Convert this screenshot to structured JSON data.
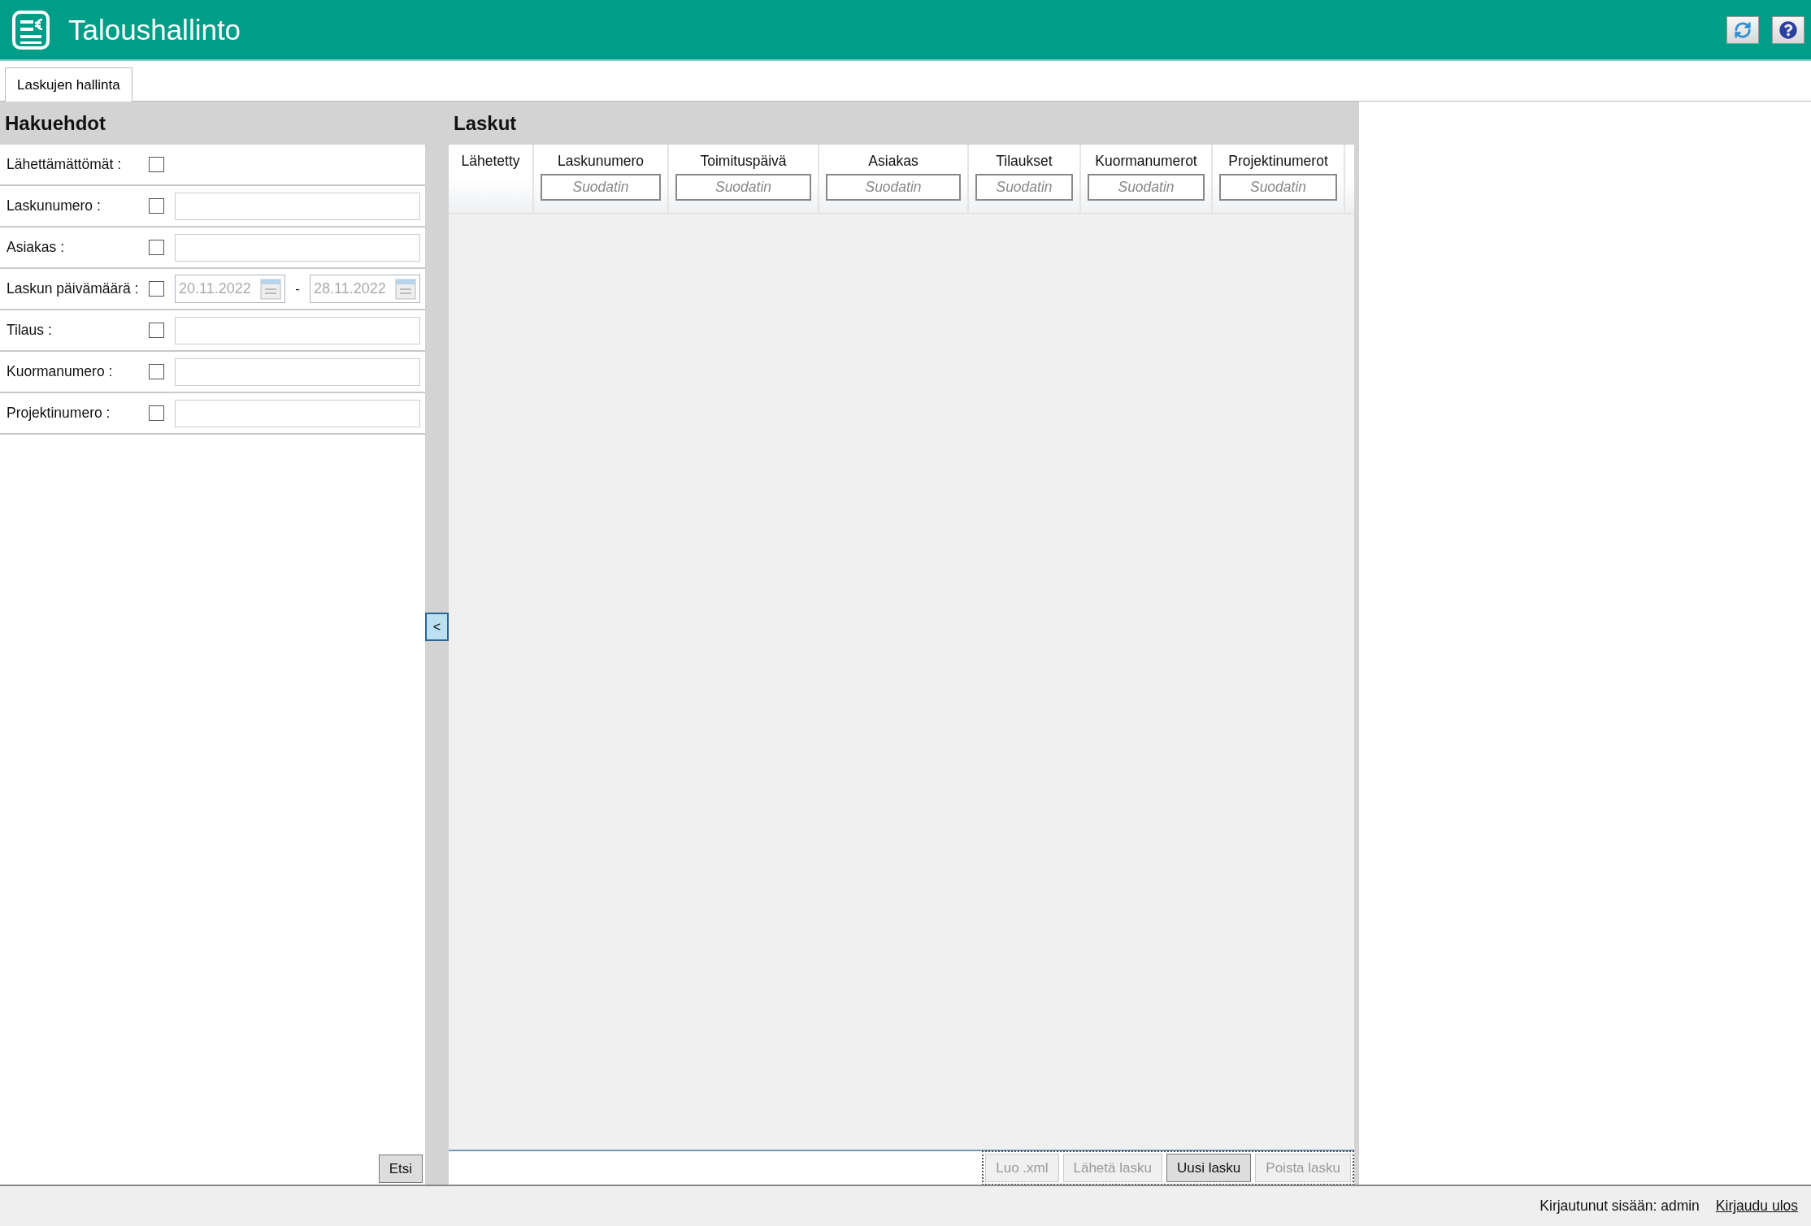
{
  "app": {
    "title": "Taloushallinto"
  },
  "tabs": [
    {
      "label": "Laskujen hallinta",
      "selected": true
    }
  ],
  "search_panel": {
    "title": "Hakuehdot",
    "fields": [
      {
        "kind": "check",
        "label": "Lähettämättömät :",
        "checked": false
      },
      {
        "kind": "text",
        "label": "Laskunumero :",
        "checked": false
      },
      {
        "kind": "text",
        "label": "Asiakas :",
        "checked": false
      },
      {
        "kind": "daterange",
        "label": "Laskun päivämäärä :",
        "checked": false,
        "from": "20.11.2022",
        "separator": "-",
        "to": "28.11.2022",
        "disabled": true
      },
      {
        "kind": "text",
        "label": "Tilaus :",
        "checked": false
      },
      {
        "kind": "text",
        "label": "Kuormanumero :",
        "checked": false
      },
      {
        "kind": "text",
        "label": "Projektinumero :",
        "checked": false
      }
    ],
    "search_button": "Etsi",
    "collapse_button": "<"
  },
  "invoices": {
    "title": "Laskut",
    "columns": [
      {
        "label": "Lähetetty"
      },
      {
        "label": "Laskunumero",
        "filter_placeholder": "Suodatin"
      },
      {
        "label": "Toimituspäivä",
        "filter_placeholder": "Suodatin"
      },
      {
        "label": "Asiakas",
        "filter_placeholder": "Suodatin"
      },
      {
        "label": "Tilaukset",
        "filter_placeholder": "Suodatin"
      },
      {
        "label": "Kuormanumerot",
        "filter_placeholder": "Suodatin"
      },
      {
        "label": "Projektinumerot",
        "filter_placeholder": "Suodatin"
      }
    ],
    "buttons": [
      {
        "label": "Luo .xml",
        "disabled": true
      },
      {
        "label": "Lähetä lasku",
        "disabled": true
      },
      {
        "label": "Uusi lasku",
        "disabled": false
      },
      {
        "label": "Poista lasku",
        "disabled": true
      }
    ]
  },
  "status_bar": {
    "user": "Kirjautunut sisään: admin",
    "logout": "Kirjaudu ulos"
  }
}
